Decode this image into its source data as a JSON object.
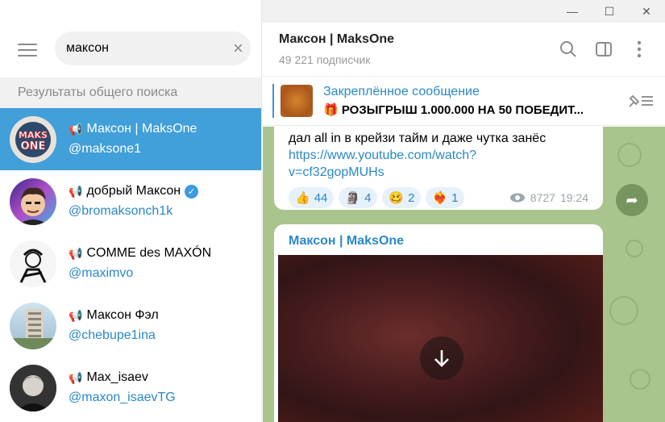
{
  "window_controls": {
    "minimize": "—",
    "maximize": "☐",
    "close": "✕"
  },
  "search": {
    "value": "максон",
    "clear_icon": "×"
  },
  "section_header": "Результаты общего поиска",
  "results": [
    {
      "name": "Максон | MaksOne",
      "handle": "@maksone1",
      "verified": false,
      "active": true,
      "avatar_text": "MAKS ONE"
    },
    {
      "name": "добрый Максон",
      "handle": "@bromaksonch1k",
      "verified": true,
      "active": false
    },
    {
      "name": "COMME des MAXÓN",
      "handle": "@maximvo",
      "verified": false,
      "active": false
    },
    {
      "name": "Максон Фэл",
      "handle": "@chebupe1ina",
      "verified": false,
      "active": false
    },
    {
      "name": "Max_isaev",
      "handle": "@maxon_isaevTG",
      "verified": false,
      "active": false
    }
  ],
  "channel_icon": "📢",
  "chat": {
    "title": "Максон | MaksOne",
    "subtitle": "49 221 подписчик"
  },
  "pinned": {
    "title": "Закреплённое сообщение",
    "text": "🎁 РОЗЫГРЫШ 1.000.000 НА 50 ПОБЕДИТ..."
  },
  "message1": {
    "text": "дал all in в крейзи тайм и даже чутка занёс",
    "link_line1": "https://www.youtube.com/watch?",
    "link_line2": "v=cf32gopMUHs",
    "reactions": [
      {
        "emoji": "👍",
        "count": "44"
      },
      {
        "emoji": "🗿",
        "count": "4"
      },
      {
        "emoji": "🥴",
        "count": "2"
      },
      {
        "emoji": "❤️‍🔥",
        "count": "1"
      }
    ],
    "views": "8727",
    "time": "19:24"
  },
  "message2": {
    "author": "Максон | MaksOne"
  },
  "colors": {
    "accent": "#419fd9",
    "link": "#2a88c8",
    "chat_bg": "#a9c58d"
  }
}
